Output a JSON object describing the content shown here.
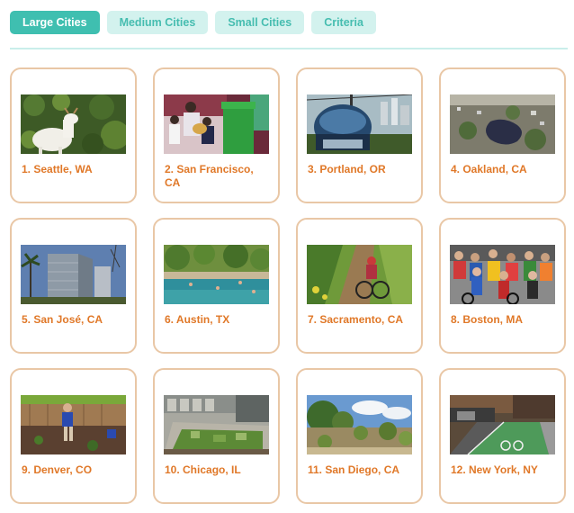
{
  "tabs": [
    {
      "label": "Large Cities",
      "active": true
    },
    {
      "label": "Medium Cities",
      "active": false
    },
    {
      "label": "Small Cities",
      "active": false
    },
    {
      "label": "Criteria",
      "active": false
    }
  ],
  "cities": [
    {
      "label": "1. Seattle, WA",
      "image": "goat-in-garden-photo"
    },
    {
      "label": "2. San Francisco, CA",
      "image": "compost-bin-photo"
    },
    {
      "label": "3. Portland, OR",
      "image": "aerial-tram-photo"
    },
    {
      "label": "4. Oakland, CA",
      "image": "aerial-lake-city-photo"
    },
    {
      "label": "5. San José, CA",
      "image": "office-towers-photo"
    },
    {
      "label": "6. Austin, TX",
      "image": "swimming-spring-photo"
    },
    {
      "label": "7. Sacramento, CA",
      "image": "mountain-biker-photo"
    },
    {
      "label": "8. Boston, MA",
      "image": "bike-crowd-photo"
    },
    {
      "label": "9. Denver, CO",
      "image": "backyard-gardener-photo"
    },
    {
      "label": "10. Chicago, IL",
      "image": "green-roof-photo"
    },
    {
      "label": "11. San Diego, CA",
      "image": "native-garden-photo"
    },
    {
      "label": "12. New York, NY",
      "image": "bike-lane-photo"
    }
  ]
}
